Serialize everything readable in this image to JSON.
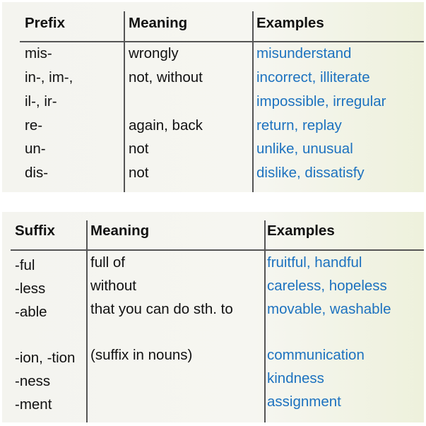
{
  "prefix_table": {
    "headers": [
      "Prefix",
      "Meaning",
      "Examples"
    ],
    "rows": [
      {
        "affix": "mis-",
        "meaning": "wrongly",
        "examples": "misunderstand"
      },
      {
        "affix": "in-, im-,",
        "meaning": "not, without",
        "examples": "incorrect, illiterate"
      },
      {
        "affix": "il-, ir-",
        "meaning": "",
        "examples": "impossible, irregular"
      },
      {
        "affix": "re-",
        "meaning": "again, back",
        "examples": "return, replay"
      },
      {
        "affix": "un-",
        "meaning": "not",
        "examples": "unlike, unusual"
      },
      {
        "affix": "dis-",
        "meaning": "not",
        "examples": "dislike, dissatisfy"
      }
    ]
  },
  "suffix_table": {
    "headers": [
      "Suffix",
      "Meaning",
      "Examples"
    ],
    "rows": [
      {
        "affix": "-ful",
        "meaning": "full of",
        "examples": "fruitful, handful"
      },
      {
        "affix": "-less",
        "meaning": "without",
        "examples": "careless, hopeless"
      },
      {
        "affix": "-able",
        "meaning": "that you can do sth. to",
        "examples": "movable, washable"
      },
      {
        "affix": "-ion, -tion",
        "meaning": "(suffix in nouns)",
        "examples": "communication"
      },
      {
        "affix": "-ness",
        "meaning": "",
        "examples": "kindness"
      },
      {
        "affix": "-ment",
        "meaning": "",
        "examples": "assignment"
      }
    ]
  },
  "colors": {
    "example_text": "#1d72bf",
    "header_text": "#111111"
  }
}
